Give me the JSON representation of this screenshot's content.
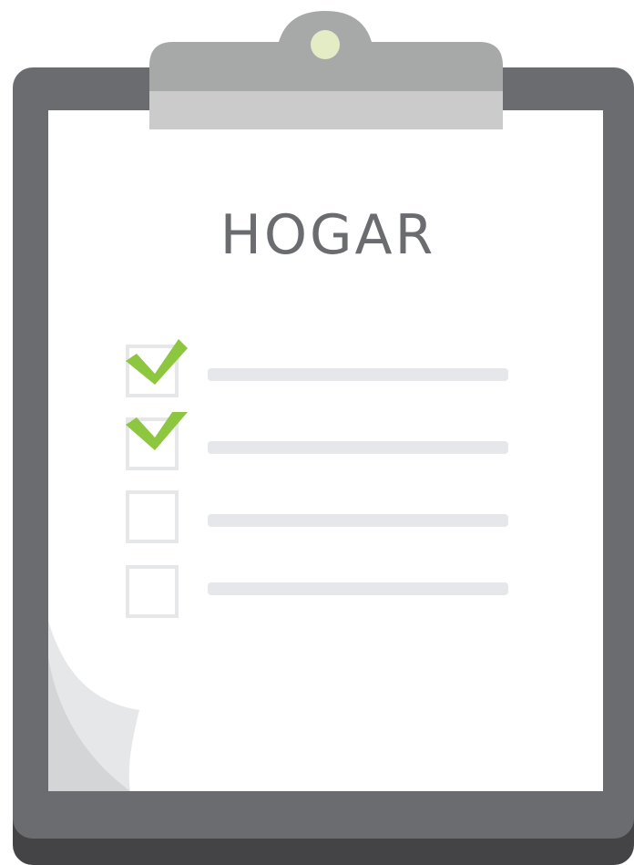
{
  "clipboard": {
    "title": "HOGAR",
    "colors": {
      "board": "#6b6c70",
      "board_shadow": "#444446",
      "paper": "#ffffff",
      "clip_top": "#a7a9a8",
      "clip_bottom": "#cbcbcb",
      "clip_dot": "#e3ecc4",
      "check": "#8dc63f",
      "box": "#e6e7e9",
      "text": "#6b6c70"
    }
  },
  "checklist": {
    "items": [
      {
        "checked": true,
        "icon": "check-mark-icon"
      },
      {
        "checked": true,
        "icon": "check-mark-icon"
      },
      {
        "checked": false,
        "icon": "empty-checkbox"
      },
      {
        "checked": false,
        "icon": "empty-checkbox"
      }
    ]
  }
}
